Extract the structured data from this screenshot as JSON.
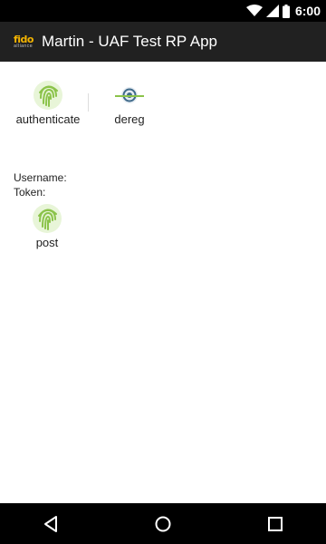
{
  "status_bar": {
    "time": "6:00"
  },
  "app_bar": {
    "logo_top": "fido",
    "logo_bottom": "alliance",
    "title": "Martin - UAF Test RP App"
  },
  "actions": {
    "authenticate": "authenticate",
    "dereg": "dereg",
    "post": "post"
  },
  "fields": {
    "username_label": "Username:",
    "token_label": "Token:"
  },
  "nav": {
    "back_icon": "back-triangle-icon",
    "home_icon": "home-circle-icon",
    "recents_icon": "recents-square-icon"
  },
  "colors": {
    "status_bar": "#000000",
    "app_bar": "#212121",
    "fingerprint_green": "#8bc34a",
    "fingerprint_dark": "#558b2f"
  }
}
